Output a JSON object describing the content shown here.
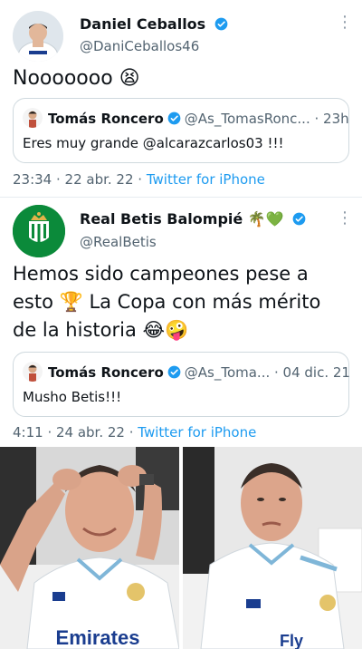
{
  "tweet1": {
    "name": "Daniel Ceballos",
    "handle": "@DaniCeballos46",
    "text": "Nooooooo 😫",
    "quote": {
      "name": "Tomás Roncero",
      "handle_time": "@As_TomasRonc... · 23h",
      "text": "Eres muy grande @alcarazcarlos03 !!!"
    },
    "time": "23:34 · 22 abr. 22 · ",
    "source": "Twitter for iPhone"
  },
  "tweet2": {
    "name": "Real Betis Balompié 🌴💚",
    "handle": "@RealBetis",
    "text_line1": "Hemos sido campeones pese a",
    "text_line2": "esto 🏆 La Copa con más mérito",
    "text_line3": "de la historia 😂🤪",
    "quote": {
      "name": "Tomás Roncero",
      "handle_time": "@As_Toma... · 04 dic. 21",
      "text": "Musho Betis!!!"
    },
    "time": "4:11 · 24 abr. 22 · ",
    "source": "Twitter for iPhone"
  },
  "photo_left": {
    "shirt_text": "Emirates"
  },
  "photo_right": {
    "shirt_text": "Fly"
  },
  "colors": {
    "accent": "#1d9bf0",
    "muted": "#536471",
    "border": "#cfd9de",
    "betis_green": "#0b8a3a"
  },
  "icons": {
    "verified": "verified-badge-icon",
    "more": "more-options-icon"
  }
}
